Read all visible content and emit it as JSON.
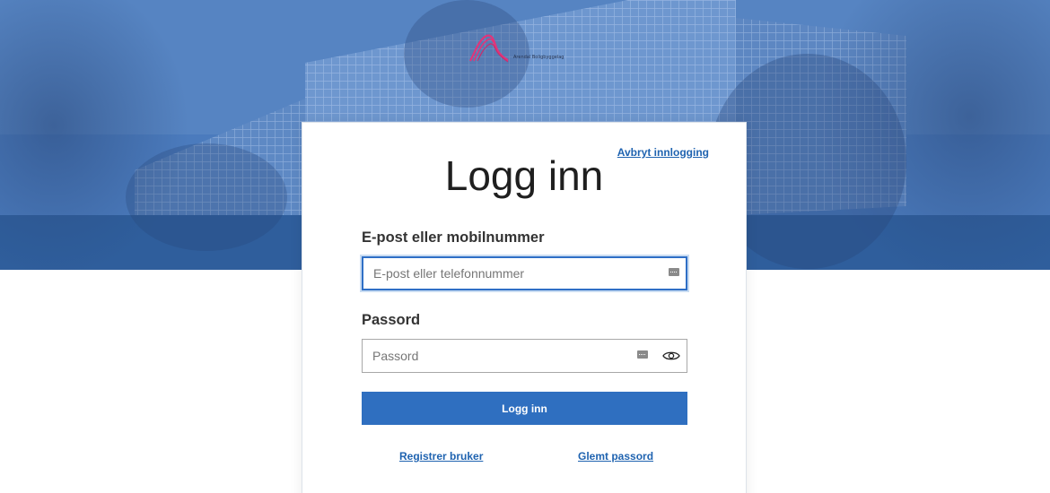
{
  "brand": {
    "logo_text": "Arendal Boligbyggelag",
    "accent_color": "#e0357a"
  },
  "login": {
    "cancel_label": "Avbryt innlogging",
    "title": "Logg inn",
    "email_label": "E-post eller mobilnummer",
    "email_placeholder": "E-post eller telefonnummer",
    "email_value": "",
    "password_label": "Passord",
    "password_placeholder": "Passord",
    "password_value": "",
    "show_password_icon": "eye-icon",
    "autofill_icon": "keyboard-icon",
    "submit_label": "Logg inn",
    "register_label": "Registrer bruker",
    "forgot_label": "Glemt passord"
  },
  "colors": {
    "primary": "#2f6fc0",
    "link": "#1f63b0",
    "hero": "#3d6eb0"
  }
}
